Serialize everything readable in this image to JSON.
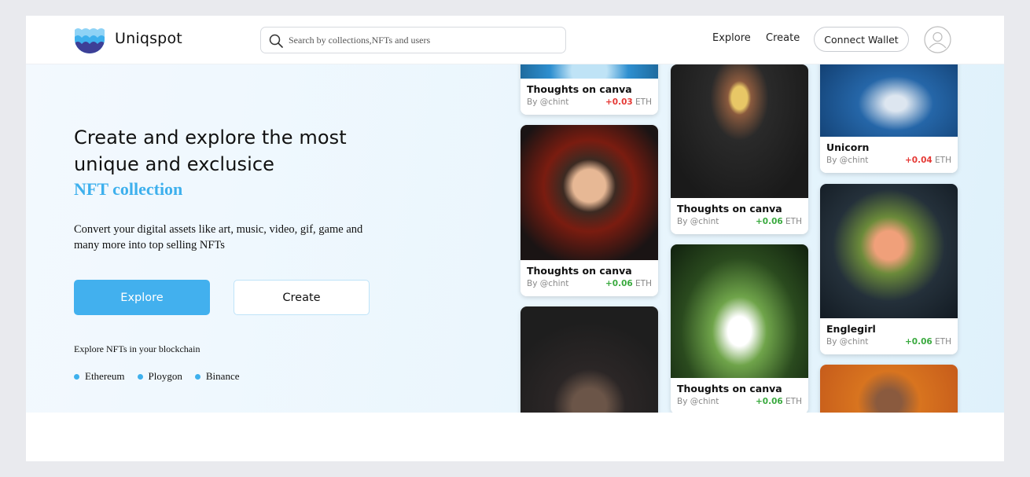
{
  "header": {
    "brand": "Uniqspot",
    "search_placeholder": "Search by collections,NFTs and users",
    "nav": [
      {
        "label": "Explore"
      },
      {
        "label": "Create"
      }
    ],
    "connect_wallet": "Connect Wallet",
    "avatar_icon": "user-circle-icon"
  },
  "hero": {
    "headline_line1": "Create and explore the most",
    "headline_line2": "unique and exclusice",
    "headline_accent": "NFT collection",
    "description": "Convert your digital assets like art, music, video, gif, game and many more into top selling NFTs",
    "explore_button": "Explore",
    "create_button": "Create",
    "chain_label": "Explore NFTs in your blockchain",
    "chains": [
      "Ethereum",
      "Ploygon",
      "Binance"
    ],
    "accent_color": "#42b0ee"
  },
  "cards": [
    {
      "column": 1,
      "title": "Thoughts on canva",
      "author": "By @chint",
      "price": "+0.03",
      "unit": "ETH",
      "trend": "down",
      "art": "blue-creature"
    },
    {
      "column": 1,
      "title": "Thoughts on canva",
      "author": "By @chint",
      "price": "+0.06",
      "unit": "ETH",
      "trend": "up",
      "art": "smoking-man-portrait"
    },
    {
      "column": 1,
      "title": "",
      "author": "",
      "price": "",
      "unit": "",
      "trend": "",
      "art": "ape-with-sunglasses"
    },
    {
      "column": 2,
      "title": "Thoughts on canva",
      "author": "By @chint",
      "price": "+0.06",
      "unit": "ETH",
      "trend": "up",
      "art": "hoodie-character"
    },
    {
      "column": 2,
      "title": "Thoughts on canva",
      "author": "By @chint",
      "price": "+0.06",
      "unit": "ETH",
      "trend": "up",
      "art": "white-creatures-in-forest"
    },
    {
      "column": 3,
      "title": "Unicorn",
      "author": "By @chint",
      "price": "+0.04",
      "unit": "ETH",
      "trend": "down",
      "art": "unicorn"
    },
    {
      "column": 3,
      "title": "Englegirl",
      "author": "By @chint",
      "price": "+0.06",
      "unit": "ETH",
      "trend": "up",
      "art": "angel-girl"
    },
    {
      "column": 3,
      "title": "",
      "author": "",
      "price": "",
      "unit": "",
      "trend": "",
      "art": "smiling-character-orange"
    }
  ],
  "colors": {
    "price_up": "#3aaa3f",
    "price_down": "#e53935",
    "logo_light": "#8fd3f6",
    "logo_mid": "#3eb0ed",
    "logo_dark": "#3d3f96"
  }
}
